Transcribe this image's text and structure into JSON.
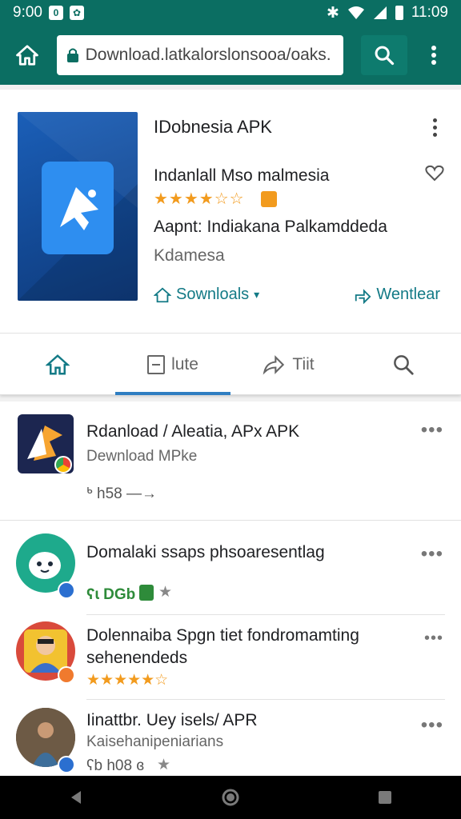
{
  "status_bar": {
    "time_left": "9:00",
    "time_right": "11:09"
  },
  "toolbar": {
    "url": "Download.latkalorslonsooa/oaks."
  },
  "featured": {
    "title": "IDobnesia APK",
    "subtitle": "Indanlall Mso malmesia",
    "rating_stars": "★★★★☆☆",
    "author": "Aapnt: Indiakana Palkamddeda",
    "category": "Kdamesa",
    "downloads_link": "Sownloals",
    "share_link": "Wentlear"
  },
  "tabs": [
    {
      "label": ""
    },
    {
      "label": "lute"
    },
    {
      "label": "Tiit"
    },
    {
      "label": ""
    }
  ],
  "list": [
    {
      "title": "Rdanload / Aleatia, APx APK",
      "subtitle": "Dewnload MPke",
      "meta": "ᒃ h58 —→"
    },
    {
      "title": "Domalaki ssaps phsoaresentlag",
      "meta": "ʕɩ DGb"
    },
    {
      "title_line1": "Dolennaiba Spgn tiet fondromamting",
      "title_line2": "sehenendeds",
      "stars": "★★★★★☆"
    },
    {
      "title": "Iinattbr. Uey isels/ APR",
      "subtitle": "Kaisehanipeniarians",
      "meta": "ʕb h08 ɞ"
    }
  ],
  "colors": {
    "brand": "#0b6e62",
    "accent": "#137a86",
    "tab_indicator": "#2f7ec2",
    "star": "#f29b1e"
  }
}
